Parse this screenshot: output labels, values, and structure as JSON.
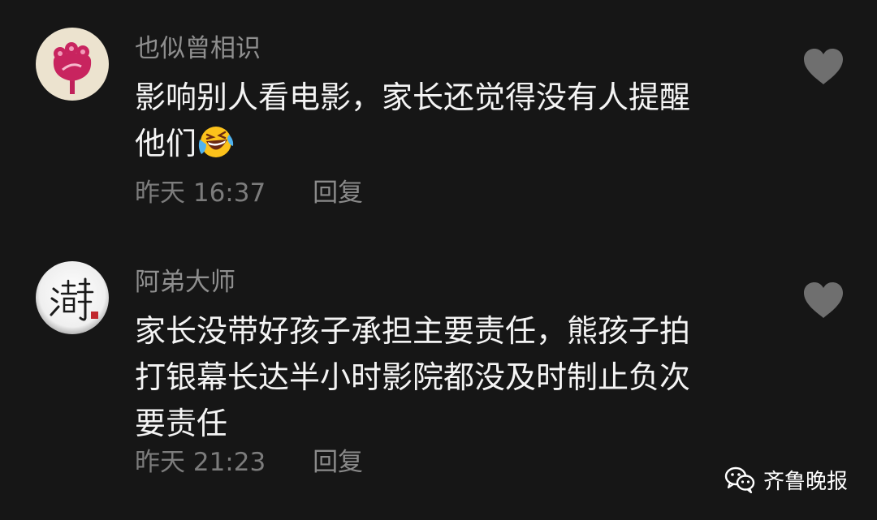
{
  "colors": {
    "background": "#161616",
    "username": "#8f8f8f",
    "text": "#f4f4f4",
    "meta": "#7c7c7c",
    "heart": "#6f6f6f"
  },
  "comments": [
    {
      "username": "也似曾相识",
      "avatar_icon": "red-flower-avatar",
      "text_lines": [
        "影响别人看电影，家长还觉得没有人提醒",
        "他们"
      ],
      "emoji": "laughing-tears-emoji",
      "time": "昨天 16:37",
      "reply_label": "回复",
      "like_icon": "heart-icon"
    },
    {
      "username": "阿弟大师",
      "avatar_icon": "calligraphy-avatar",
      "avatar_char": "静",
      "text_lines": [
        "家长没带好孩子承担主要责任，熊孩子拍",
        "打银幕长达半小时影院都没及时制止负次",
        "要责任"
      ],
      "time": "昨天 21:23",
      "reply_label": "回复",
      "like_icon": "heart-icon"
    }
  ],
  "watermark": {
    "icon": "wechat-icon",
    "label": "齐鲁晚报"
  }
}
